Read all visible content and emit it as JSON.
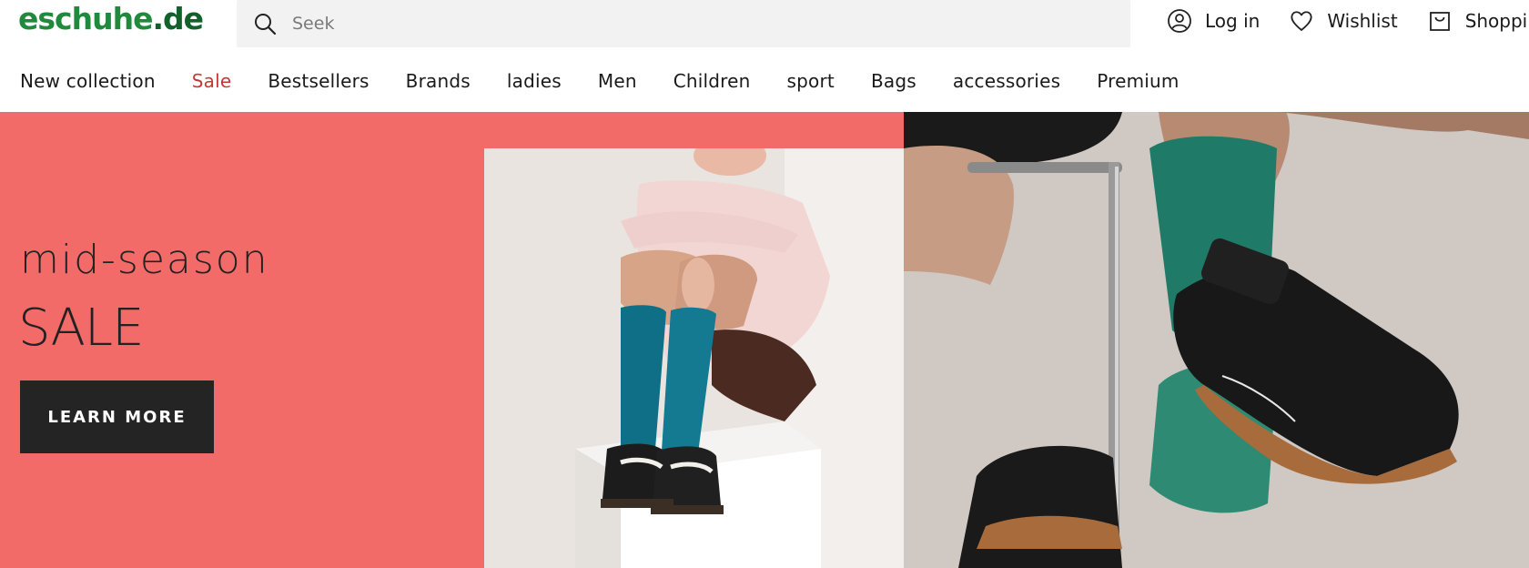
{
  "header": {
    "logo": {
      "brand": "eschuhe",
      "tld": ".de"
    },
    "search": {
      "placeholder": "Seek",
      "value": "",
      "icon": "search-icon"
    },
    "actions": [
      {
        "label": "Log in",
        "icon": "user-icon"
      },
      {
        "label": "Wishlist",
        "icon": "heart-icon"
      },
      {
        "label": "Shoppin",
        "icon": "shopping-bag-icon"
      }
    ]
  },
  "nav": {
    "items": [
      {
        "label": "New collection"
      },
      {
        "label": "Sale",
        "highlight_color": "#c93636"
      },
      {
        "label": "Bestsellers"
      },
      {
        "label": "Brands"
      },
      {
        "label": "ladies"
      },
      {
        "label": "Men"
      },
      {
        "label": "Children"
      },
      {
        "label": "sport"
      },
      {
        "label": "Bags"
      },
      {
        "label": "accessories"
      },
      {
        "label": "Premium"
      }
    ]
  },
  "hero": {
    "kicker": "mid-season",
    "title": "SALE",
    "cta_label": "LEARN MORE",
    "background_color": "#f26b69"
  }
}
